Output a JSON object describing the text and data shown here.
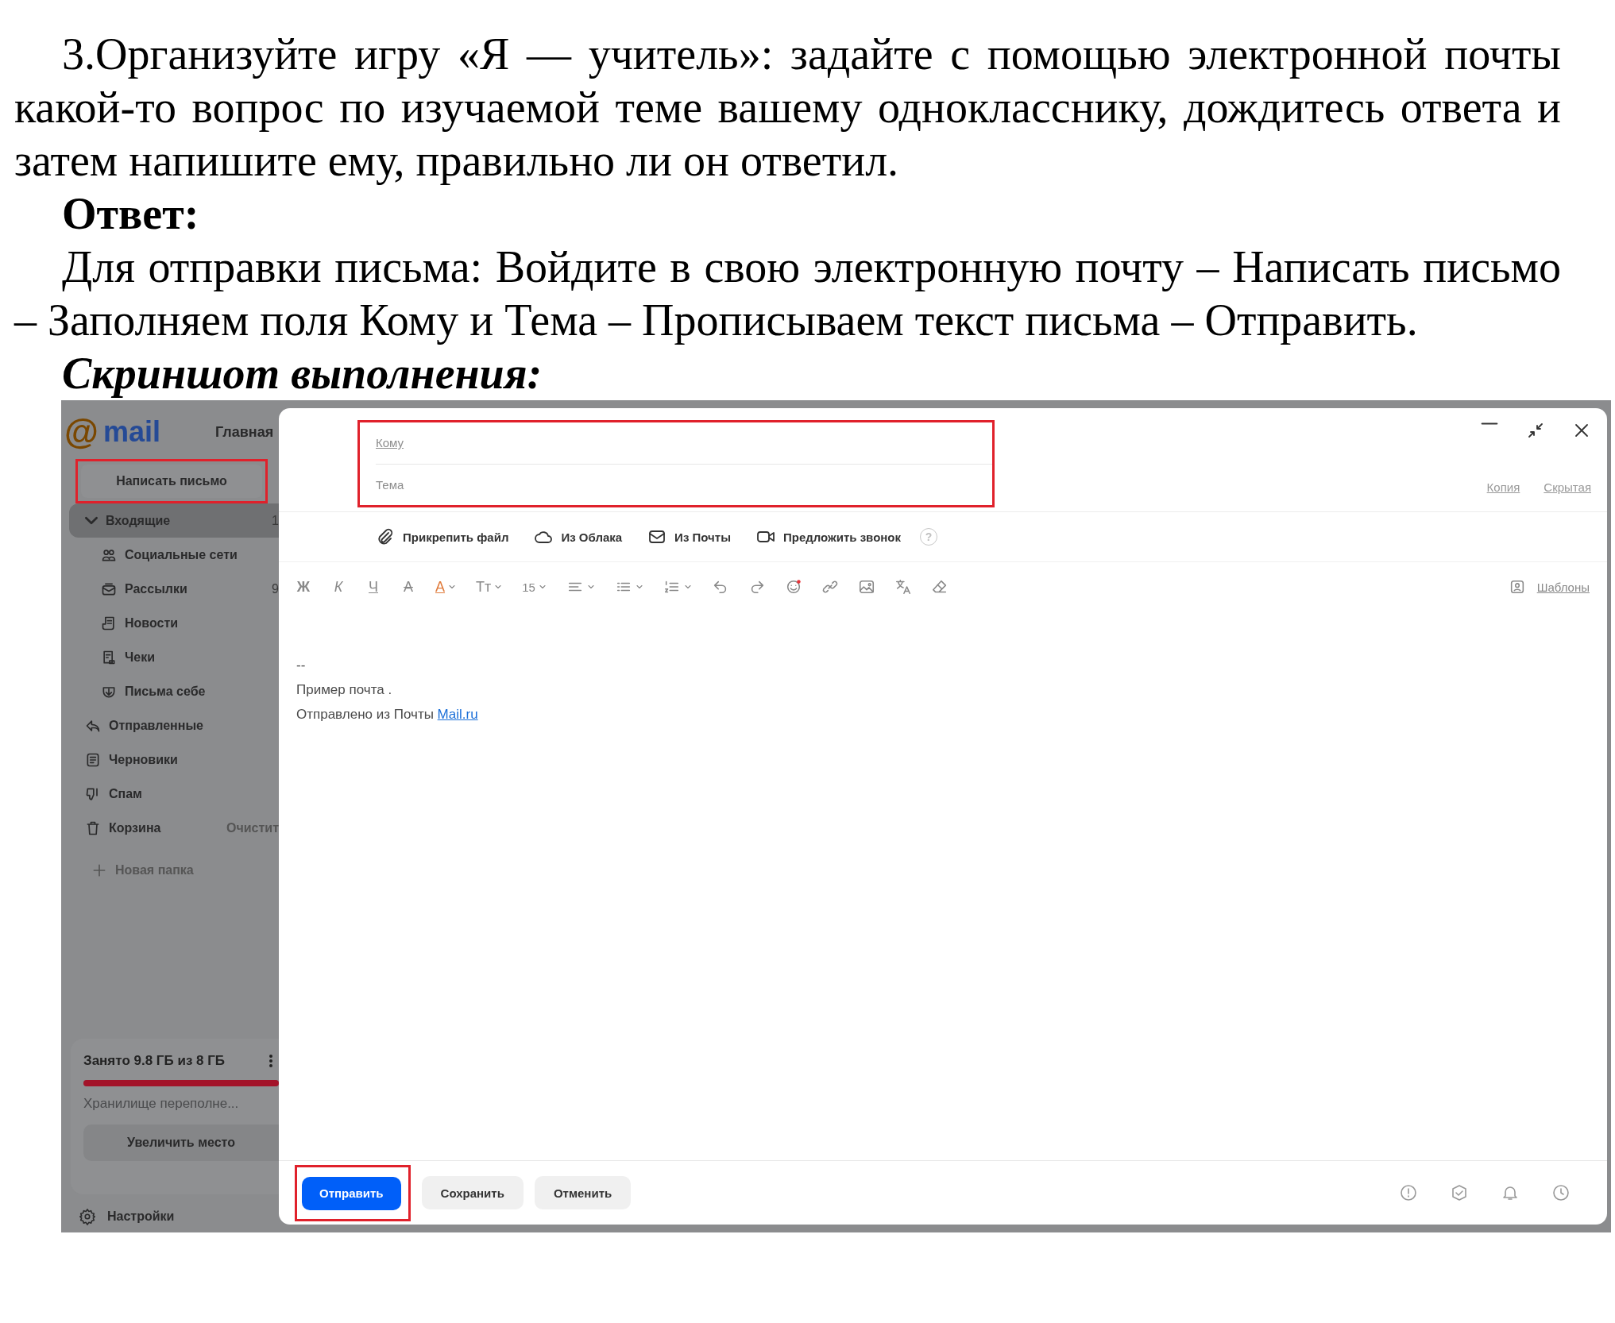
{
  "exercise": {
    "text": "3.Организуйте игру «Я — учитель»: задайте с помощью электронной почты какой-то вопрос по изучаемой теме вашему однокласснику, дождитесь ответа и затем напишите ему, правильно ли он ответил."
  },
  "answer": {
    "heading": "Ответ:",
    "text": "Для отправки письма: Войдите в свою электронную почту – Написать письмо – Заполняем поля Кому и Тема – Прописываем текст письма – Отправить."
  },
  "screenshot_heading": "Скриншот выполнения:",
  "screenshot": {
    "sidebar": {
      "logo": {
        "symbol": "@",
        "text": "mail"
      },
      "top_link": "Главная",
      "compose_button": {
        "label": "Написать письмо",
        "highlighted": true
      },
      "folders": [
        {
          "kind": "inbox",
          "label": "Входящие",
          "count": "1",
          "selected": true,
          "expanded": true,
          "children": [
            {
              "kind": "social",
              "label": "Социальные сети",
              "selected": false
            },
            {
              "kind": "newsletters",
              "label": "Рассылки",
              "count": "9",
              "selected": false
            },
            {
              "kind": "news",
              "label": "Новости",
              "selected": false
            },
            {
              "kind": "receipts",
              "label": "Чеки",
              "selected": false
            },
            {
              "kind": "self",
              "label": "Письма себе",
              "selected": false
            }
          ]
        },
        {
          "kind": "sent",
          "label": "Отправленные",
          "selected": false
        },
        {
          "kind": "drafts",
          "label": "Черновики",
          "selected": false
        },
        {
          "kind": "spam",
          "label": "Спам",
          "selected": false
        },
        {
          "kind": "trash",
          "label": "Корзина",
          "action": "Очистит",
          "selected": false
        }
      ],
      "new_folder": "Новая папка",
      "storage": {
        "text": "Занято 9.8 ГБ из 8 ГБ",
        "level": 1,
        "warning": "Хранилище переполне...",
        "button": "Увеличить место"
      },
      "settings": "Настройки"
    },
    "compose": {
      "window_controls": [
        {
          "kind": "minimize"
        },
        {
          "kind": "collapse"
        },
        {
          "kind": "close"
        }
      ],
      "fields_highlighted": true,
      "to_label": "Кому",
      "subject_label": "Тема",
      "copy_link": "Копия",
      "hidden_copy_link": "Скрытая",
      "attachments": [
        {
          "kind": "clip",
          "label": "Прикрепить файл"
        },
        {
          "kind": "cloud",
          "label": "Из Облака"
        },
        {
          "kind": "mail",
          "label": "Из Почты"
        },
        {
          "kind": "video",
          "label": "Предложить звонок"
        }
      ],
      "help": "?",
      "toolbar": [
        {
          "kind": "bold",
          "label": "Ж",
          "caret": false
        },
        {
          "kind": "italic",
          "label": "К",
          "caret": false
        },
        {
          "kind": "underline",
          "label": "Ч",
          "caret": false
        },
        {
          "kind": "strike",
          "label": "A",
          "caret": false
        },
        {
          "kind": "color",
          "label": "A",
          "caret": true
        },
        {
          "kind": "size",
          "label": "Тт",
          "caret": true
        },
        {
          "kind": "fontsize",
          "label": "15",
          "caret": true
        },
        {
          "kind": "align",
          "caret": true
        },
        {
          "kind": "list",
          "caret": true
        },
        {
          "kind": "numbered",
          "caret": true
        },
        {
          "kind": "undo",
          "caret": false
        },
        {
          "kind": "redo",
          "caret": false
        },
        {
          "kind": "emoji",
          "caret": false
        },
        {
          "kind": "link",
          "caret": false
        },
        {
          "kind": "image",
          "caret": false
        },
        {
          "kind": "translate",
          "caret": false
        },
        {
          "kind": "eraser",
          "caret": false
        }
      ],
      "templates": "Шаблоны",
      "body": {
        "separator": "--",
        "signature": "Пример почта .",
        "sent_from": "Отправлено из Почты ",
        "link": "Mail.ru"
      },
      "buttons": [
        {
          "kind": "primary",
          "label": "Отправить",
          "highlighted": true
        },
        {
          "kind": "secondary",
          "label": "Сохранить",
          "highlighted": false
        },
        {
          "kind": "secondary",
          "label": "Отменить",
          "highlighted": false
        }
      ],
      "footer_icons": [
        {
          "kind": "alert"
        },
        {
          "kind": "check"
        },
        {
          "kind": "bell"
        },
        {
          "kind": "clock"
        }
      ]
    }
  }
}
